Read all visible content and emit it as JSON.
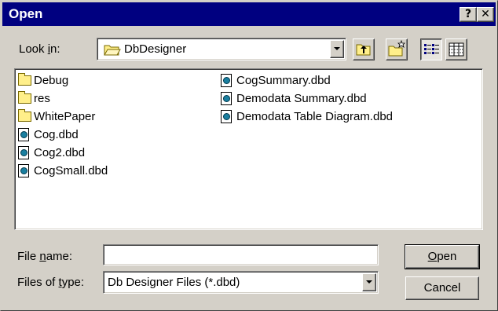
{
  "window": {
    "title": "Open"
  },
  "titlebar_buttons": {
    "help": "?",
    "close": "✕"
  },
  "look_in": {
    "label_pre": "Look ",
    "label_accel": "i",
    "label_post": "n:",
    "value": "DbDesigner",
    "icon": "folder-open-icon"
  },
  "toolbar": {
    "buttons": [
      {
        "name": "up-one-level",
        "icon": "up-folder-icon"
      },
      {
        "name": "create-new-folder",
        "icon": "new-folder-icon"
      },
      {
        "name": "list-view",
        "icon": "list-view-icon",
        "pressed": true
      },
      {
        "name": "details-view",
        "icon": "details-view-icon"
      }
    ]
  },
  "files": {
    "column1": [
      {
        "name": "Debug",
        "type": "folder"
      },
      {
        "name": "res",
        "type": "folder"
      },
      {
        "name": "WhitePaper",
        "type": "folder"
      },
      {
        "name": "Cog.dbd",
        "type": "dbd"
      },
      {
        "name": "Cog2.dbd",
        "type": "dbd"
      },
      {
        "name": "CogSmall.dbd",
        "type": "dbd"
      }
    ],
    "column2": [
      {
        "name": "CogSummary.dbd",
        "type": "dbd"
      },
      {
        "name": "Demodata Summary.dbd",
        "type": "dbd"
      },
      {
        "name": "Demodata Table Diagram.dbd",
        "type": "dbd"
      }
    ]
  },
  "file_name": {
    "label_pre": "File ",
    "label_accel": "n",
    "label_post": "ame:",
    "value": ""
  },
  "file_type": {
    "label_pre": "Files of ",
    "label_accel": "t",
    "label_post": "ype:",
    "value": "Db Designer Files (*.dbd)"
  },
  "buttons": {
    "open_accel": "O",
    "open_rest": "pen",
    "cancel": "Cancel"
  },
  "colors": {
    "titlebar": "#000080",
    "face": "#d4d0c8",
    "folder": "#ffef8a",
    "dbd_icon": "#1a7fa0"
  }
}
